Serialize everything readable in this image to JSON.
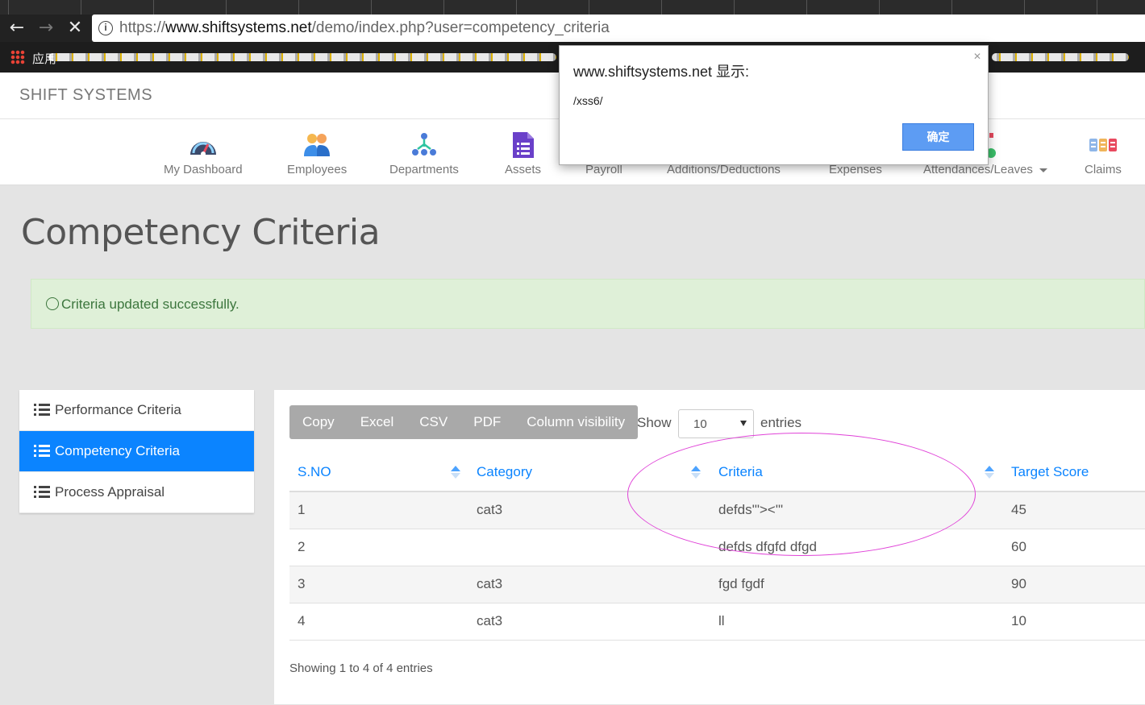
{
  "browser": {
    "url_prefix": "https://",
    "url_host": "www.shiftsystems.net",
    "url_path": "/demo/index.php?user=competency_criteria",
    "apps_label": "应用"
  },
  "site": {
    "brand": "SHIFT SYSTEMS"
  },
  "menu": [
    {
      "label": "My Dashboard",
      "icon": "dashboard-icon"
    },
    {
      "label": "Employees",
      "icon": "employees-icon"
    },
    {
      "label": "Departments",
      "icon": "departments-icon"
    },
    {
      "label": "Assets",
      "icon": "assets-icon"
    },
    {
      "label": "Payroll",
      "icon": "payroll-icon"
    },
    {
      "label": "Additions/Deductions",
      "icon": "additions-icon"
    },
    {
      "label": "Expenses",
      "icon": "expenses-icon"
    },
    {
      "label": "Attendances/Leaves",
      "icon": "attendance-icon"
    },
    {
      "label": "Claims",
      "icon": "claims-icon"
    }
  ],
  "page": {
    "title": "Competency Criteria"
  },
  "alert": {
    "text": "Criteria updated successfully."
  },
  "sidenav": [
    {
      "label": "Performance Criteria",
      "active": false
    },
    {
      "label": "Competency Criteria",
      "active": true
    },
    {
      "label": "Process Appraisal",
      "active": false
    }
  ],
  "table_tools": {
    "buttons": [
      "Copy",
      "Excel",
      "CSV",
      "PDF",
      "Column visibility"
    ],
    "show_label": "Show",
    "entries_value": "10",
    "entries_label": "entries"
  },
  "table": {
    "headers": [
      "S.NO",
      "Category",
      "Criteria",
      "Target Score"
    ],
    "rows": [
      [
        "1",
        "cat3",
        "defds'\"><'\"",
        "45"
      ],
      [
        "2",
        "",
        "defds dfgfd dfgd",
        "60"
      ],
      [
        "3",
        "cat3",
        "fgd fgdf",
        "90"
      ],
      [
        "4",
        "cat3",
        "ll",
        "10"
      ]
    ],
    "info": "Showing 1 to 4 of 4 entries"
  },
  "dialog": {
    "title": "www.shiftsystems.net 显示:",
    "message": "/xss6/",
    "ok_label": "确定"
  },
  "colors": {
    "primary": "#0b84ff",
    "alert_bg": "#dff0d8",
    "alert_text": "#3c763d",
    "highlight": "#e043d8"
  }
}
